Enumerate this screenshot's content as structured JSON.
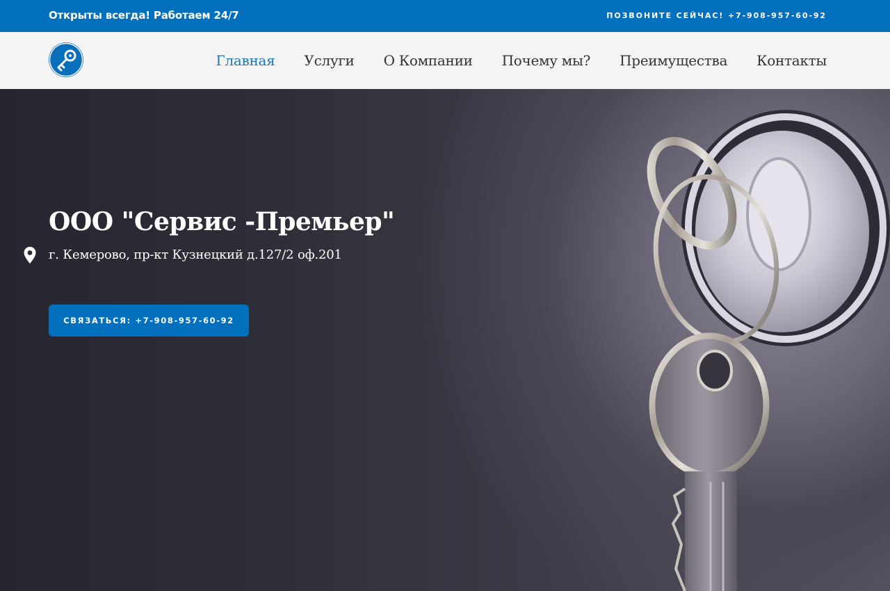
{
  "topbar": {
    "left_text": "Открыты всегда! Работаем 24/7",
    "right_text": "ПОЗВОНИТЕ СЕЙЧАС! +7-908-957-60-92"
  },
  "brand": {
    "logo_icon": "key-icon",
    "accent": "#0270bd"
  },
  "nav": {
    "items": [
      {
        "label": "Главная",
        "active": true
      },
      {
        "label": "Услуги"
      },
      {
        "label": "О Компании"
      },
      {
        "label": "Почему мы?"
      },
      {
        "label": "Преимущества"
      },
      {
        "label": "Контакты"
      }
    ]
  },
  "hero": {
    "company_name": "ООО \"Сервис -Премьер\"",
    "address": "г. Кемерово, пр-кт Кузнецкий д.127/2 оф.201",
    "address_icon": "location-pin-icon",
    "cta_label": "СВЯЗАТЬСЯ: +7-908-957-60-92",
    "image": "keys-in-lock-photo"
  }
}
